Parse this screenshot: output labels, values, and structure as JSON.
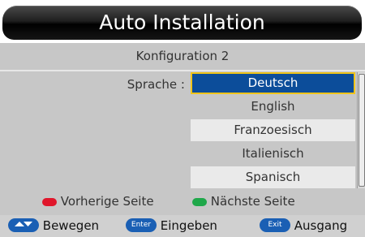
{
  "title": "Auto Installation",
  "subtitle": "Konfiguration 2",
  "language": {
    "label": "Sprache :",
    "options": [
      "Deutsch",
      "English",
      "Franzoesisch",
      "Italienisch",
      "Spanisch"
    ],
    "selected": "Deutsch"
  },
  "paging": {
    "prev_label": "Vorherige Seite",
    "next_label": "Nächste Seite",
    "prev_color": "#e0162b",
    "next_color": "#1fa84a"
  },
  "footer": {
    "move_label": "Bewegen",
    "enter_key": "Enter",
    "enter_label": "Eingeben",
    "exit_key": "Exit",
    "exit_label": "Ausgang"
  },
  "colors": {
    "selection": "#0c4d9a",
    "selection_border": "#f0c419",
    "key_button": "#1a5fb4"
  }
}
